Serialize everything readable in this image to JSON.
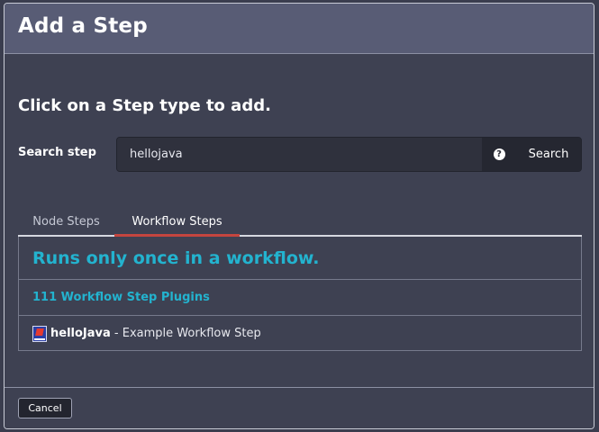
{
  "dialog": {
    "title": "Add a Step",
    "heading": "Click on a Step type to add."
  },
  "search": {
    "label": "Search step",
    "value": "hellojava",
    "help_icon": "question-circle-icon",
    "help_glyph": "?",
    "button_label": "Search"
  },
  "tabs": [
    {
      "label": "Node Steps",
      "active": false
    },
    {
      "label": "Workflow Steps",
      "active": true
    }
  ],
  "list": {
    "intro": "Runs only once in a workflow.",
    "plugins_link": "111 Workflow Step Plugins",
    "items": [
      {
        "icon": "plugin-icon",
        "name": "helloJava",
        "separator": " - ",
        "description": "Example Workflow Step"
      }
    ]
  },
  "footer": {
    "cancel_label": "Cancel"
  },
  "colors": {
    "accent": "#23b3cf",
    "active_tab": "#c4453f",
    "header_bg": "#585c75",
    "body_bg": "#3e4152"
  }
}
